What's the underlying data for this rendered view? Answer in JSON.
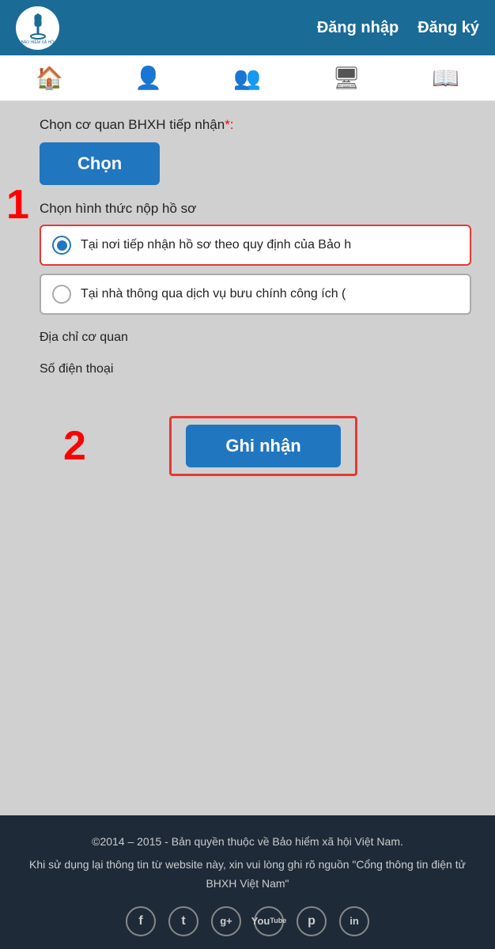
{
  "header": {
    "login_label": "Đăng nhập",
    "register_label": "Đăng ký"
  },
  "nav": {
    "icons": [
      "🏠",
      "👤",
      "👥",
      "🖥",
      "📖"
    ]
  },
  "main": {
    "choose_agency_label": "Chọn cơ quan BHXH tiếp nhận",
    "required_mark": "*:",
    "choose_btn_label": "Chọn",
    "annotation_1": "1",
    "choose_form_label": "Chọn hình thức nộp hồ sơ",
    "radio_option_1": "Tại nơi tiếp nhận hồ sơ theo quy định của Bảo h",
    "radio_option_2": "Tại nhà thông qua dịch vụ bưu chính công ích (",
    "address_label": "Địa chỉ cơ quan",
    "phone_label": "Số điện thoại",
    "annotation_2": "2",
    "submit_btn_label": "Ghi nhận"
  },
  "footer": {
    "copyright": "©2014 – 2015 - Bản quyền thuộc về Bảo hiểm xã hội Việt Nam.",
    "notice": "Khi sử dụng lại thông tin từ website này, xin vui lòng ghi rõ nguồn \"Cổng thông tin điện tử BHXH Việt Nam\"",
    "social_icons": [
      "f",
      "t",
      "g+",
      "▶",
      "p",
      "in"
    ]
  }
}
